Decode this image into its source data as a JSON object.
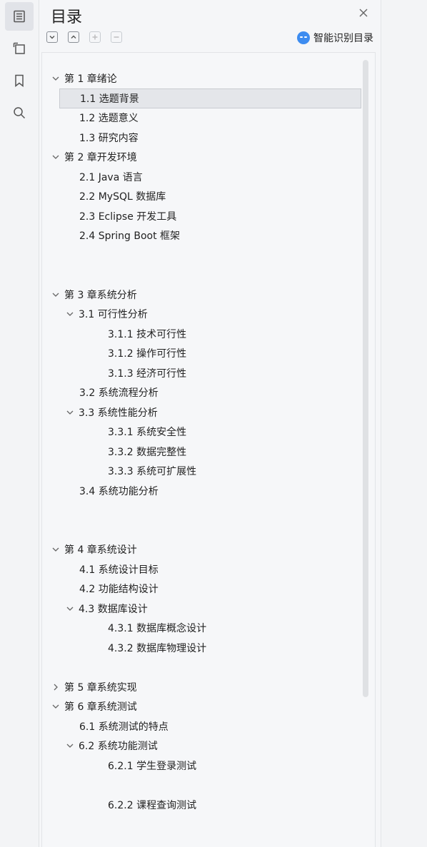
{
  "panel": {
    "title": "目录",
    "smart_label": "智能识别目录"
  },
  "rail": {
    "items": [
      {
        "icon": "toc-icon",
        "active": true
      },
      {
        "icon": "outline-icon",
        "active": false
      },
      {
        "icon": "bookmark-icon",
        "active": false
      },
      {
        "icon": "search-icon",
        "active": false
      }
    ]
  },
  "toolbar": {
    "buttons": [
      {
        "icon": "expand-all-icon",
        "enabled": true
      },
      {
        "icon": "collapse-all-icon",
        "enabled": true
      },
      {
        "icon": "add-icon",
        "enabled": false
      },
      {
        "icon": "remove-icon",
        "enabled": false
      }
    ]
  },
  "toc": [
    {
      "label": "第 1 章绪论",
      "level": 0,
      "toggle": "expanded"
    },
    {
      "label": "1.1  选题背景",
      "level": 1,
      "toggle": "none",
      "selected": true
    },
    {
      "label": "1.2  选题意义",
      "level": 1,
      "toggle": "none"
    },
    {
      "label": "1.3  研究内容",
      "level": 1,
      "toggle": "none"
    },
    {
      "label": "第 2 章开发环境",
      "level": 0,
      "toggle": "expanded"
    },
    {
      "label": "2.1 Java 语言",
      "level": 1,
      "toggle": "none"
    },
    {
      "label": "2.2 MySQL 数据库",
      "level": 1,
      "toggle": "none"
    },
    {
      "label": "2.3 Eclipse 开发工具",
      "level": 1,
      "toggle": "none"
    },
    {
      "label": "2.4 Spring Boot 框架",
      "level": 1,
      "toggle": "none"
    },
    {
      "label": "",
      "level": 1,
      "toggle": "none"
    },
    {
      "label": "",
      "level": 1,
      "toggle": "none"
    },
    {
      "label": "第 3 章系统分析",
      "level": 0,
      "toggle": "expanded"
    },
    {
      "label": "3.1 可行性分析",
      "level": 1,
      "toggle": "expanded"
    },
    {
      "label": "3.1.1 技术可行性",
      "level": 2,
      "toggle": "none"
    },
    {
      "label": "3.1.2 操作可行性",
      "level": 2,
      "toggle": "none"
    },
    {
      "label": "3.1.3 经济可行性",
      "level": 2,
      "toggle": "none"
    },
    {
      "label": "3.2 系统流程分析",
      "level": 1,
      "toggle": "none"
    },
    {
      "label": "3.3 系统性能分析",
      "level": 1,
      "toggle": "expanded"
    },
    {
      "label": "3.3.1 系统安全性",
      "level": 2,
      "toggle": "none"
    },
    {
      "label": "3.3.2 数据完整性",
      "level": 2,
      "toggle": "none"
    },
    {
      "label": "3.3.3 系统可扩展性",
      "level": 2,
      "toggle": "none"
    },
    {
      "label": "3.4 系统功能分析",
      "level": 1,
      "toggle": "none"
    },
    {
      "label": "",
      "level": 1,
      "toggle": "none"
    },
    {
      "label": "",
      "level": 1,
      "toggle": "none"
    },
    {
      "label": "第 4 章系统设计",
      "level": 0,
      "toggle": "expanded"
    },
    {
      "label": "4.1  系统设计目标",
      "level": 1,
      "toggle": "none"
    },
    {
      "label": "4.2 功能结构设计",
      "level": 1,
      "toggle": "none"
    },
    {
      "label": "4.3 数据库设计",
      "level": 1,
      "toggle": "expanded"
    },
    {
      "label": "4.3.1  数据库概念设计",
      "level": 2,
      "toggle": "none"
    },
    {
      "label": "4.3.2  数据库物理设计",
      "level": 2,
      "toggle": "none"
    },
    {
      "label": "",
      "level": 1,
      "toggle": "none"
    },
    {
      "label": "第 5 章系统实现",
      "level": 0,
      "toggle": "collapsed"
    },
    {
      "label": "第 6 章系统测试",
      "level": 0,
      "toggle": "expanded"
    },
    {
      "label": "6.1 系统测试的特点",
      "level": 1,
      "toggle": "none"
    },
    {
      "label": "6.2  系统功能测试",
      "level": 1,
      "toggle": "expanded"
    },
    {
      "label": "6.2.1  学生登录测试",
      "level": 2,
      "toggle": "none"
    },
    {
      "label": "",
      "level": 2,
      "toggle": "none"
    },
    {
      "label": "6.2.2  课程查询测试",
      "level": 2,
      "toggle": "none"
    }
  ]
}
